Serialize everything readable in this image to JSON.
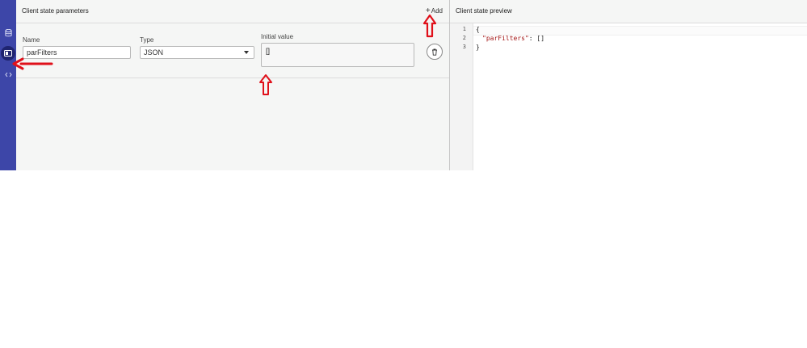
{
  "left_panel": {
    "title": "Client state parameters",
    "add_label": "Add",
    "add_icon": "plus-icon"
  },
  "parameter_row": {
    "name_label": "Name",
    "name_value": "parFilters",
    "type_label": "Type",
    "type_value": "JSON",
    "initial_label": "Initial value",
    "initial_value": "[]",
    "delete_icon": "trash-icon"
  },
  "right_panel": {
    "title": "Client state preview",
    "lines": [
      {
        "no": "1",
        "text": "{"
      },
      {
        "no": "2",
        "key": "\"parFilters\"",
        "rest": ": []"
      },
      {
        "no": "3",
        "text": "}"
      }
    ]
  },
  "rail": {
    "icons": [
      "database-icon",
      "client-state-icon",
      "code-icon"
    ],
    "active": "client-state-icon"
  },
  "colors": {
    "rail": "#3d46a8",
    "rail_active": "#1f2470",
    "annotation": "#e0101a",
    "json_key": "#a31515"
  }
}
